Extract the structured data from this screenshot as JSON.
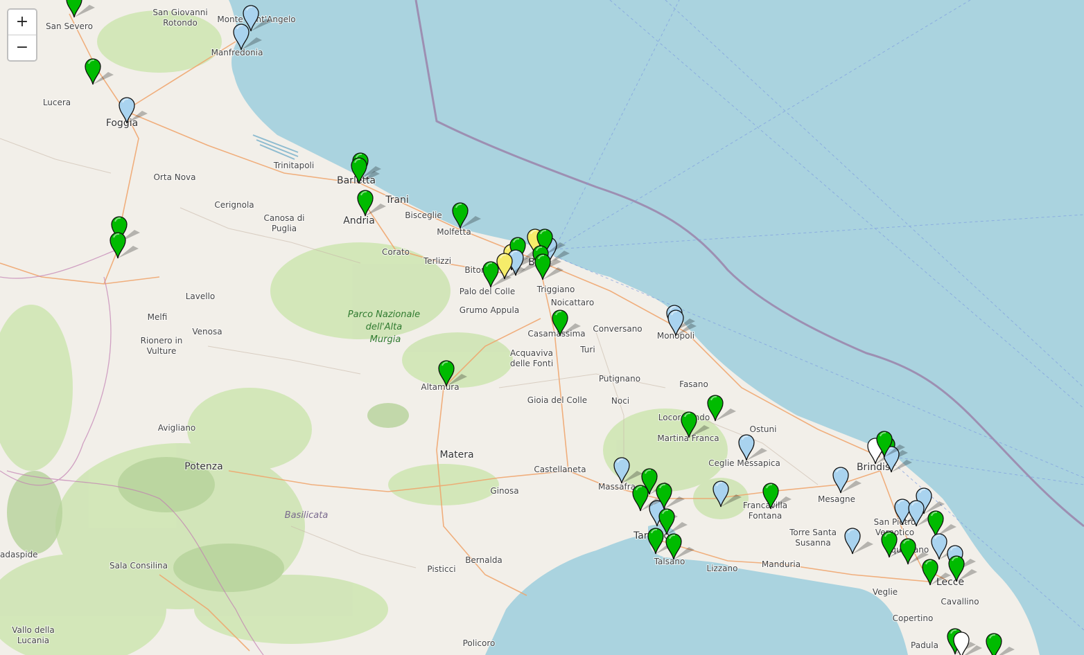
{
  "zoom": {
    "in_label": "+",
    "out_label": "−"
  },
  "colors": {
    "sea": "#aad3df",
    "land": "#f2efe9",
    "green_area": "#cfe5b4",
    "green_dark": "#b5d29a",
    "road": "#f0a36a",
    "boundary": "#9a7ea6",
    "pin_green": "#00bb00",
    "pin_lightblue": "#a9d3ef",
    "pin_yellow": "#f5ec6a",
    "pin_white": "#ffffff"
  },
  "places": [
    {
      "name": "San Severo",
      "size": "normal"
    },
    {
      "name": "San Giovanni\nRotondo",
      "size": "normal"
    },
    {
      "name": "Monte Sant'Angelo",
      "size": "normal"
    },
    {
      "name": "Manfredonia",
      "size": "normal"
    },
    {
      "name": "Lucera",
      "size": "normal"
    },
    {
      "name": "Foggia",
      "size": "big"
    },
    {
      "name": "Trinitapoli",
      "size": "normal"
    },
    {
      "name": "Orta Nova",
      "size": "normal"
    },
    {
      "name": "Barletta",
      "size": "big"
    },
    {
      "name": "Trani",
      "size": "big"
    },
    {
      "name": "Cerignola",
      "size": "normal"
    },
    {
      "name": "Canosa di\nPuglia",
      "size": "normal"
    },
    {
      "name": "Andria",
      "size": "big"
    },
    {
      "name": "Bisceglie",
      "size": "normal"
    },
    {
      "name": "Molfetta",
      "size": "normal"
    },
    {
      "name": "Corato",
      "size": "normal"
    },
    {
      "name": "Terlizzi",
      "size": "normal"
    },
    {
      "name": "Bitonto",
      "size": "normal"
    },
    {
      "name": "Bari",
      "size": "big"
    },
    {
      "name": "Palo del Colle",
      "size": "normal"
    },
    {
      "name": "Triggiano",
      "size": "normal"
    },
    {
      "name": "Noicattaro",
      "size": "normal"
    },
    {
      "name": "Lavello",
      "size": "normal"
    },
    {
      "name": "Grumo Appula",
      "size": "normal"
    },
    {
      "name": "Melfi",
      "size": "normal"
    },
    {
      "name": "Venosa",
      "size": "normal"
    },
    {
      "name": "Casamassima",
      "size": "normal"
    },
    {
      "name": "Conversano",
      "size": "normal"
    },
    {
      "name": "Monopoli",
      "size": "normal"
    },
    {
      "name": "Rionero in\nVulture",
      "size": "normal"
    },
    {
      "name": "Acquaviva\ndelle Fonti",
      "size": "normal"
    },
    {
      "name": "Turi",
      "size": "normal"
    },
    {
      "name": "Altamura",
      "size": "normal"
    },
    {
      "name": "Putignano",
      "size": "normal"
    },
    {
      "name": "Fasano",
      "size": "normal"
    },
    {
      "name": "Gioia del Colle",
      "size": "normal"
    },
    {
      "name": "Noci",
      "size": "normal"
    },
    {
      "name": "Locorotondo",
      "size": "normal"
    },
    {
      "name": "Avigliano",
      "size": "normal"
    },
    {
      "name": "Ostuni",
      "size": "normal"
    },
    {
      "name": "Martina Franca",
      "size": "normal"
    },
    {
      "name": "Matera",
      "size": "big"
    },
    {
      "name": "Ceglie Messapica",
      "size": "normal"
    },
    {
      "name": "Potenza",
      "size": "big"
    },
    {
      "name": "Castellaneta",
      "size": "normal"
    },
    {
      "name": "Brindisi",
      "size": "big"
    },
    {
      "name": "Massafra",
      "size": "normal"
    },
    {
      "name": "Ginosa",
      "size": "normal"
    },
    {
      "name": "Francavilla\nFontana",
      "size": "normal"
    },
    {
      "name": "Mesagne",
      "size": "normal"
    },
    {
      "name": "San Pietro\nVernotico",
      "size": "normal"
    },
    {
      "name": "Taranto",
      "size": "big"
    },
    {
      "name": "Torre Santa\nSusanna",
      "size": "normal"
    },
    {
      "name": "Squinzano",
      "size": "normal"
    },
    {
      "name": "Talsano",
      "size": "normal"
    },
    {
      "name": "Bernalda",
      "size": "normal"
    },
    {
      "name": "Manduria",
      "size": "normal"
    },
    {
      "name": "Lizzano",
      "size": "normal"
    },
    {
      "name": "Lecce",
      "size": "big"
    },
    {
      "name": "Sala Consilina",
      "size": "normal"
    },
    {
      "name": "Pisticci",
      "size": "normal"
    },
    {
      "name": "Veglie",
      "size": "normal"
    },
    {
      "name": "Cavallino",
      "size": "normal"
    },
    {
      "name": "Copertino",
      "size": "normal"
    },
    {
      "name": "Vallo della\nLucania",
      "size": "normal"
    },
    {
      "name": "Policoro",
      "size": "normal"
    },
    {
      "name": "Padula",
      "size": "normal"
    },
    {
      "name": "cadaspide",
      "size": "normal"
    }
  ],
  "park_label": "Parco Nazionale\ndell'Alta\nMurgia",
  "region_label": "Basilicata",
  "markers": [
    {
      "color": "green"
    },
    {
      "color": "lightblue"
    },
    {
      "color": "lightblue"
    },
    {
      "color": "green"
    },
    {
      "color": "lightblue"
    },
    {
      "color": "green"
    },
    {
      "color": "green"
    },
    {
      "color": "green"
    },
    {
      "color": "green"
    },
    {
      "color": "green"
    },
    {
      "color": "yellow"
    },
    {
      "color": "green"
    },
    {
      "color": "yellow"
    },
    {
      "color": "lightblue"
    },
    {
      "color": "yellow"
    },
    {
      "color": "green"
    },
    {
      "color": "lightblue"
    },
    {
      "color": "green"
    },
    {
      "color": "green"
    },
    {
      "color": "green"
    },
    {
      "color": "green"
    },
    {
      "color": "lightblue"
    },
    {
      "color": "lightblue"
    },
    {
      "color": "green"
    },
    {
      "color": "green"
    },
    {
      "color": "green"
    },
    {
      "color": "lightblue"
    },
    {
      "color": "lightblue"
    },
    {
      "color": "lightblue"
    },
    {
      "color": "green"
    },
    {
      "color": "green"
    },
    {
      "color": "lightblue"
    },
    {
      "color": "green"
    },
    {
      "color": "green"
    },
    {
      "color": "green"
    },
    {
      "color": "green"
    },
    {
      "color": "green"
    },
    {
      "color": "lightblue"
    },
    {
      "color": "green"
    },
    {
      "color": "green"
    },
    {
      "color": "white"
    },
    {
      "color": "lightblue"
    },
    {
      "color": "lightblue"
    },
    {
      "color": "lightblue"
    },
    {
      "color": "lightblue"
    },
    {
      "color": "green"
    },
    {
      "color": "lightblue"
    },
    {
      "color": "lightblue"
    },
    {
      "color": "green"
    },
    {
      "color": "green"
    },
    {
      "color": "lightblue"
    },
    {
      "color": "green"
    },
    {
      "color": "green"
    },
    {
      "color": "green"
    },
    {
      "color": "green"
    },
    {
      "color": "white"
    },
    {
      "color": "green"
    }
  ]
}
